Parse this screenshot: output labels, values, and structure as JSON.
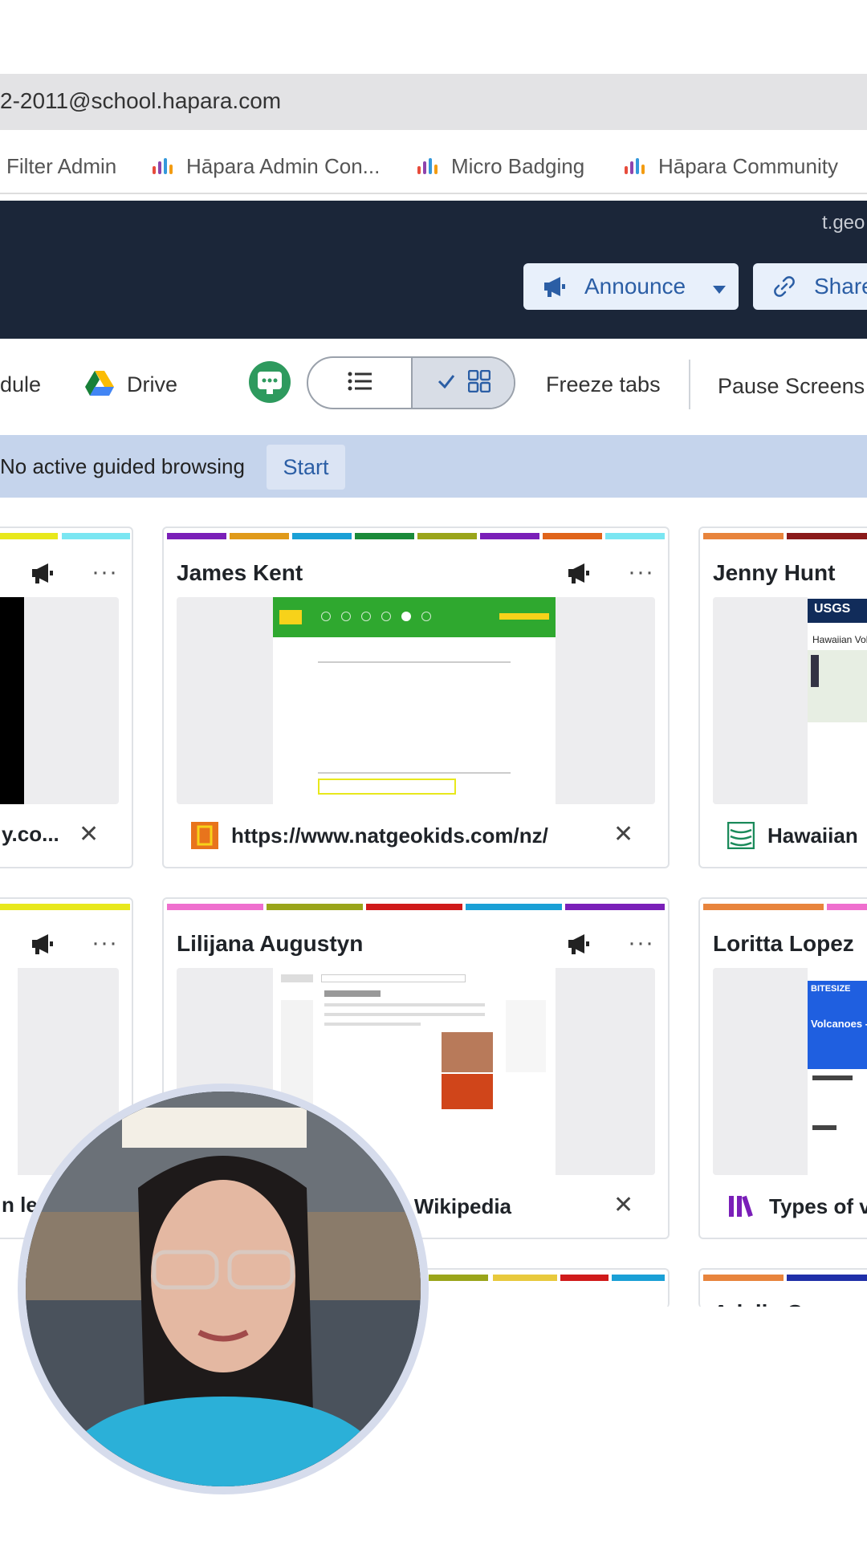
{
  "browser": {
    "url": "2-2011@school.hapara.com",
    "bookmarks": [
      "Filter Admin",
      "Hāpara Admin Con...",
      "Micro Badging",
      "Hāpara Community"
    ]
  },
  "header": {
    "user": "t.geo",
    "announce_label": "Announce",
    "share_label": "Share"
  },
  "toolbar": {
    "schedule_label": "dule",
    "drive_label": "Drive",
    "freeze_label": "Freeze tabs",
    "pause_label": "Pause Screens"
  },
  "guided_browsing": {
    "message": "No active guided browsing",
    "start_label": "Start"
  },
  "cards": [
    {
      "name": "",
      "url": "y.co..."
    },
    {
      "name": "James Kent",
      "url": "https://www.natgeokids.com/nz/"
    },
    {
      "name": "Jenny Hunt",
      "url": "Hawaiian"
    },
    {
      "name": "",
      "url": "n lec"
    },
    {
      "name": "Lilijana Augustyn",
      "url": "- Wikipedia"
    },
    {
      "name": "Loritta Lopez",
      "url": "Types of v"
    },
    {
      "name": "Adalia Cruz"
    }
  ],
  "thumbnails": {
    "usgs_brand": "USGS",
    "usgs_title": "Hawaiian Vol",
    "bbc_brand": "BITESIZE",
    "bbc_title": "Volcanoes -"
  },
  "colors": {
    "topbar": "#1b2639",
    "accent": "#2b5ea5",
    "banner": "#c5d4ec"
  }
}
